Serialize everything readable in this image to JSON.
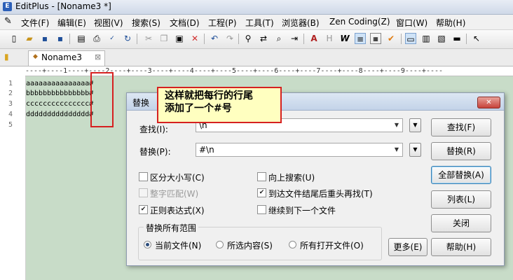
{
  "window": {
    "title": "EditPlus - [Noname3 *]"
  },
  "menu": [
    "文件(F)",
    "编辑(E)",
    "视图(V)",
    "搜索(S)",
    "文档(D)",
    "工程(P)",
    "工具(T)",
    "浏览器(B)",
    "Zen Coding(Z)",
    "窗口(W)",
    "帮助(H)"
  ],
  "tab": {
    "label": "Noname3",
    "close": "⊠"
  },
  "ruler": "----+----1----+----2----+----3----+----4----+----5----+----6----+----7----+----8----+----9----+----",
  "editor": {
    "line_numbers": [
      "1",
      "2",
      "3",
      "4",
      "5"
    ],
    "lines": [
      "aaaaaaaaaaaaaaa#",
      "bbbbbbbbbbbbbbb#",
      "ccccccccccccccc#",
      "ddddddddddddddd#",
      ""
    ]
  },
  "callout": {
    "line1": "这样就把每行的行尾",
    "line2": "添加了一个#号"
  },
  "dialog": {
    "title": "替换",
    "find_label": "查找(I):",
    "find_value": "\\n",
    "replace_label": "替换(P):",
    "replace_value": "#\\n",
    "buttons": {
      "find": "查找(F)",
      "replace": "替换(R)",
      "replace_all": "全部替换(A)",
      "list": "列表(L)",
      "close": "关闭",
      "more": "更多(E)",
      "help": "帮助(H)"
    },
    "options": {
      "match_case": "区分大小写(C)",
      "whole_word": "整字匹配(W)",
      "regex": "正则表达式(X)",
      "search_up": "向上搜索(U)",
      "wrap": "到达文件结尾后重头再找(T)",
      "next_file": "继续到下一个文件"
    },
    "scope": {
      "title": "替换所有范围",
      "current": "当前文件(N)",
      "selection": "所选内容(S)",
      "all_open": "所有打开文件(O)"
    }
  }
}
